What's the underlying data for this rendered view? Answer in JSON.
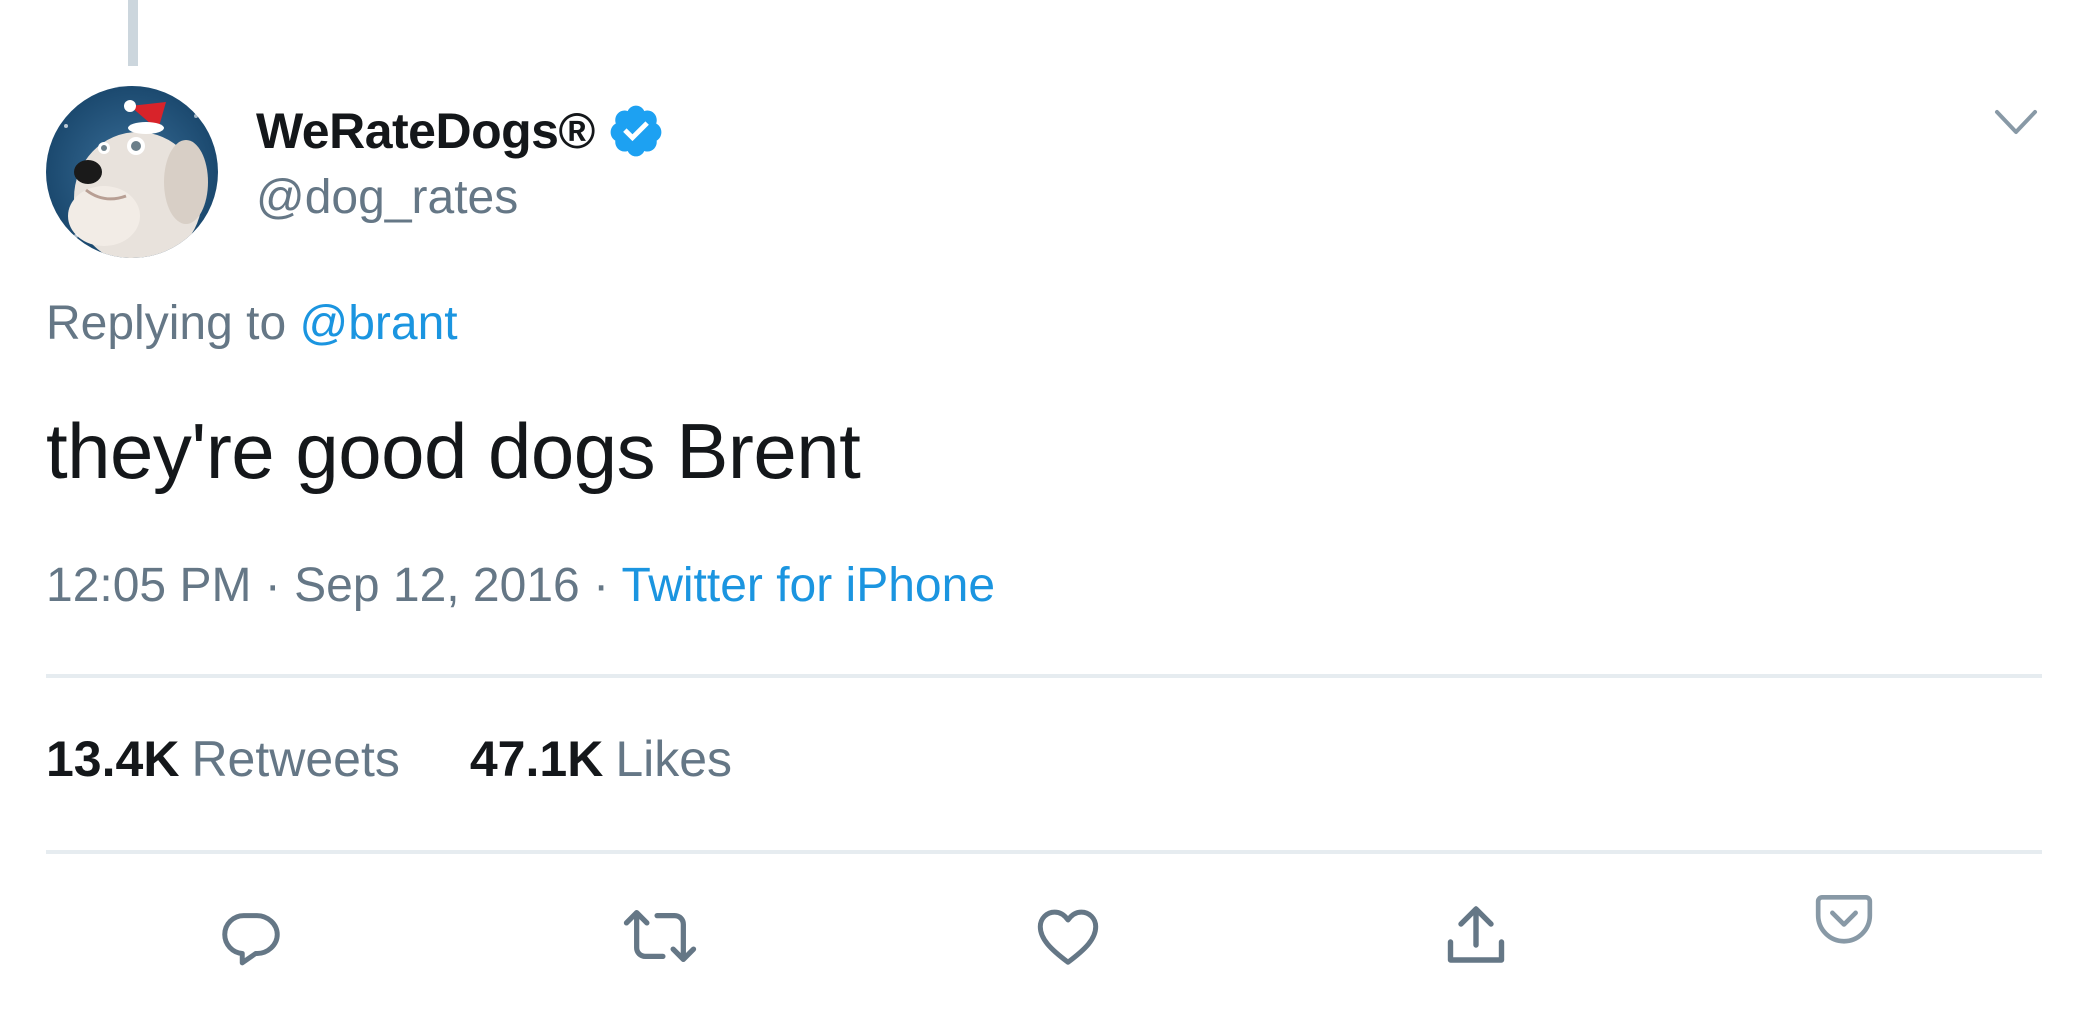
{
  "tweet": {
    "display_name": "WeRateDogs®",
    "handle": "@dog_rates",
    "replying_prefix": "Replying to",
    "replying_to": "@brant",
    "text": "they're good dogs Brent",
    "time": "12:05 PM",
    "date": "Sep 12, 2016",
    "source": "Twitter for iPhone",
    "retweets_count": "13.4K",
    "retweets_label": "Retweets",
    "likes_count": "47.1K",
    "likes_label": "Likes"
  },
  "icons": {
    "verified": "verified-badge-icon",
    "caret": "chevron-down-icon",
    "reply": "reply-icon",
    "retweet": "retweet-icon",
    "like": "heart-icon",
    "share": "share-icon",
    "pocket": "pocket-icon"
  },
  "colors": {
    "link": "#1b95e0",
    "text_primary": "#14171a",
    "text_secondary": "#657786",
    "divider": "#e6ecf0",
    "verified": "#1da1f2"
  }
}
